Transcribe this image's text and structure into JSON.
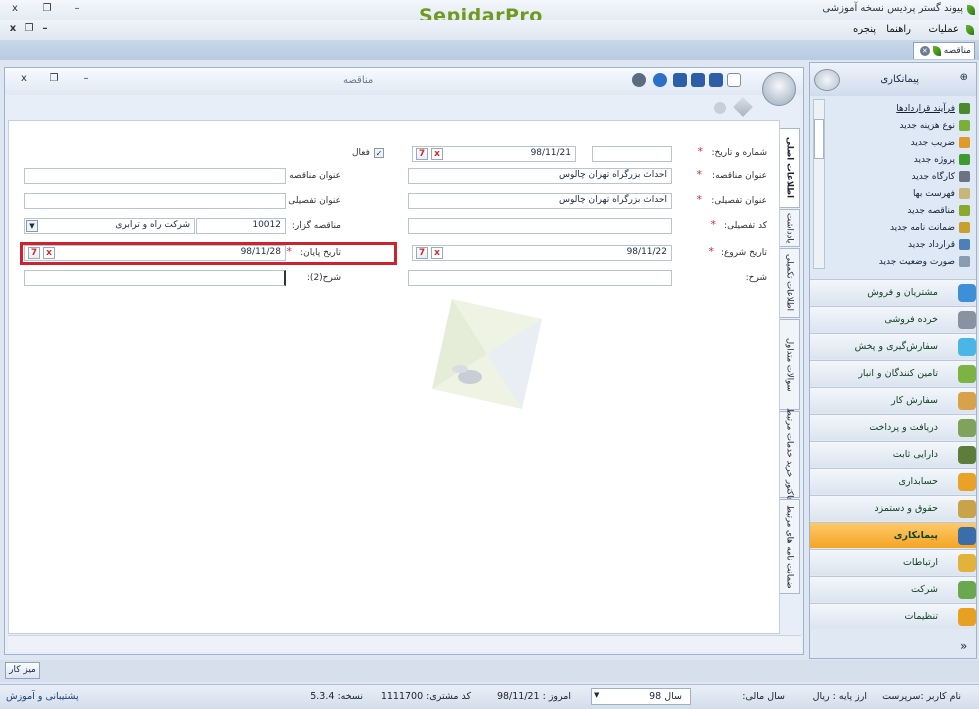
{
  "window": {
    "app_logo": "SepidarPro",
    "title": "پیوند گستر پردیس نسخه آموزشی",
    "controls": {
      "close": "x",
      "restore": "❐",
      "minimize": "–"
    }
  },
  "menubar": {
    "items": [
      "عملیات",
      "راهنما",
      "پنجره"
    ],
    "controls": {
      "close": "x",
      "restore": "❐",
      "minimize": "–"
    }
  },
  "doc_tab": {
    "label": "مناقصه"
  },
  "doc_window": {
    "title": "مناقصه",
    "controls": {
      "close": "x",
      "restore": "❐",
      "minimize": "–"
    }
  },
  "form": {
    "number_date_label": "شماره و تاریخ:",
    "number_value": "",
    "date_value": "98/11/21",
    "active_label": "فعال",
    "active_checked": true,
    "title_label": "عنوان مناقصه:",
    "title_value": "احداث بزرگراه تهران چالوس",
    "title2_label": "عنوان مناقصه (2):",
    "title2_value": "",
    "detail_title_label": "عنوان تفصیلی:",
    "detail_title_value": "احداث بزرگراه تهران چالوس",
    "detail_title2_label": "عنوان تفصیلی (2):",
    "detail_title2_value": "",
    "detail_code_label": "کد تفصیلی:",
    "detail_code_value": "",
    "tenderer_label": "مناقصه گزار:",
    "tenderer_code": "10012",
    "tenderer_name": "شرکت راه و ترابری",
    "start_date_label": "تاریخ شروع:",
    "start_date_value": "98/11/22",
    "end_date_label": "تاریخ پایان:",
    "end_date_value": "98/11/28",
    "desc_label": "شرح:",
    "desc_value": "",
    "desc2_label": "شرح(2):",
    "desc2_value": "",
    "required_mark": "*",
    "cal_glyph": "7",
    "clear_glyph": "x"
  },
  "side_tabs": [
    "اطلاعات اصلی",
    "یادداشت",
    "اطلاعات تکمیلی",
    "سوالات متداول",
    "فاکتور خرید خدمات مرتبط",
    "ضمانت نامه های مرتبط"
  ],
  "right_panel": {
    "header": "پیمانکاری",
    "pin": "⊕",
    "list": [
      {
        "label": "فرآیند قراردادها",
        "icon": "process-icon",
        "color": "#4a8a2a"
      },
      {
        "label": "نوع هزینه جدید",
        "icon": "cost-type-icon",
        "color": "#7cae3a"
      },
      {
        "label": "ضریب جدید",
        "icon": "percent-icon",
        "color": "#e09a2a"
      },
      {
        "label": "پروژه جدید",
        "icon": "project-icon",
        "color": "#3e9b2f"
      },
      {
        "label": "کارگاه جدید",
        "icon": "workshop-icon",
        "color": "#6b7480"
      },
      {
        "label": "فهرست بها",
        "icon": "price-list-icon",
        "color": "#c9b57a"
      },
      {
        "label": "مناقصه جدید",
        "icon": "tender-icon",
        "color": "#8aa72e"
      },
      {
        "label": "ضمانت نامه جدید",
        "icon": "guarantee-icon",
        "color": "#c7a030"
      },
      {
        "label": "قرارداد جدید",
        "icon": "contract-icon",
        "color": "#4e7fb8"
      },
      {
        "label": "صورت وضعیت جدید",
        "icon": "statement-icon",
        "color": "#8a9ab0"
      }
    ],
    "nav": [
      {
        "label": "مشتریان و فروش",
        "icon": "sales-icon",
        "color": "#3f8fd8"
      },
      {
        "label": "خرده فروشی",
        "icon": "retail-icon",
        "color": "#8892a0"
      },
      {
        "label": "سفارش‌گیری و پخش",
        "icon": "distribution-icon",
        "color": "#49b6e6"
      },
      {
        "label": "تامین کنندگان و انبار",
        "icon": "supplier-icon",
        "color": "#7cb342"
      },
      {
        "label": "سفارش کار",
        "icon": "work-order-icon",
        "color": "#d8a24a"
      },
      {
        "label": "دریافت و پرداخت",
        "icon": "payment-icon",
        "color": "#7fa35a"
      },
      {
        "label": "دارایی ثابت",
        "icon": "asset-icon",
        "color": "#5e7c3a"
      },
      {
        "label": "حسابداری",
        "icon": "accounting-icon",
        "color": "#e8a228"
      },
      {
        "label": "حقوق و دستمزد",
        "icon": "payroll-icon",
        "color": "#c9a24a"
      },
      {
        "label": "پیمانکاری",
        "icon": "contracting-icon",
        "color": "#3b6ea8",
        "active": true
      },
      {
        "label": "ارتباطات",
        "icon": "communication-icon",
        "color": "#e2b33a"
      },
      {
        "label": "شرکت",
        "icon": "company-icon",
        "color": "#6aa84f"
      },
      {
        "label": "تنظیمات",
        "icon": "settings-icon",
        "color": "#e8a020"
      }
    ],
    "more": "»"
  },
  "taskbar": {
    "desktop": "میز کار"
  },
  "statusbar": {
    "user": "نام کاربر :سرپرست",
    "currency": "ارز پایه : ریال",
    "fiscal_label": "سال مالی:",
    "fiscal_value": "سال 98",
    "today": "امروز : 98/11/21",
    "customer_code": "کد مشتری: 1111700",
    "version": "نسخه: 5.3.4",
    "support": "پشتیبانی و آموزش"
  }
}
